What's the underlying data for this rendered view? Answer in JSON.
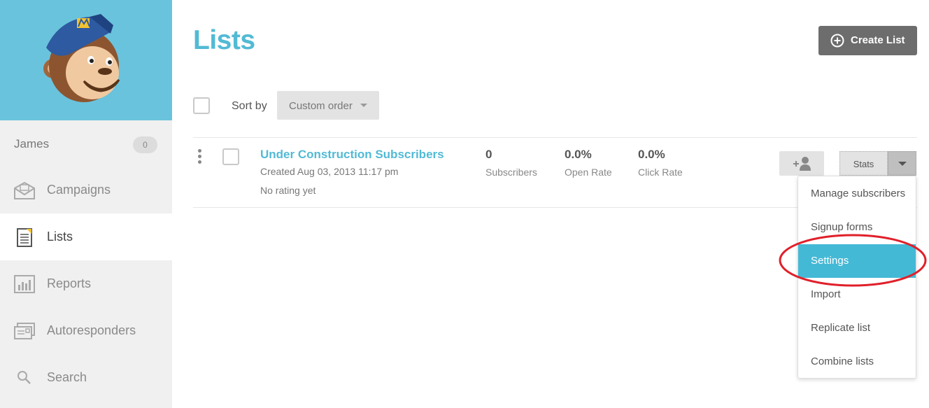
{
  "sidebar": {
    "user_name": "James",
    "user_badge": "0",
    "items": [
      {
        "label": "Campaigns",
        "icon": "envelope-icon"
      },
      {
        "label": "Lists",
        "icon": "list-document-icon"
      },
      {
        "label": "Reports",
        "icon": "bar-chart-icon"
      },
      {
        "label": "Autoresponders",
        "icon": "stacked-mail-icon"
      },
      {
        "label": "Search",
        "icon": "search-icon"
      }
    ],
    "active_item": "Lists"
  },
  "header": {
    "title": "Lists",
    "create_label": "Create List"
  },
  "toolbar": {
    "sort_label": "Sort by",
    "sort_value": "Custom order"
  },
  "list_row": {
    "name": "Under Construction Subscribers",
    "created": "Created Aug 03, 2013 11:17 pm",
    "rating": "No rating yet",
    "stats": [
      {
        "value": "0",
        "caption": "Subscribers"
      },
      {
        "value": "0.0%",
        "caption": "Open Rate"
      },
      {
        "value": "0.0%",
        "caption": "Click Rate"
      }
    ],
    "stats_button": "Stats"
  },
  "dropdown": {
    "items": [
      "Manage subscribers",
      "Signup forms",
      "Settings",
      "Import",
      "Replicate list",
      "Combine lists"
    ],
    "highlighted": "Settings"
  },
  "colors": {
    "accent": "#52bad5",
    "logo_bg": "#6ac3dd",
    "highlight": "#44b9d6",
    "annotation": "#e0202a"
  }
}
